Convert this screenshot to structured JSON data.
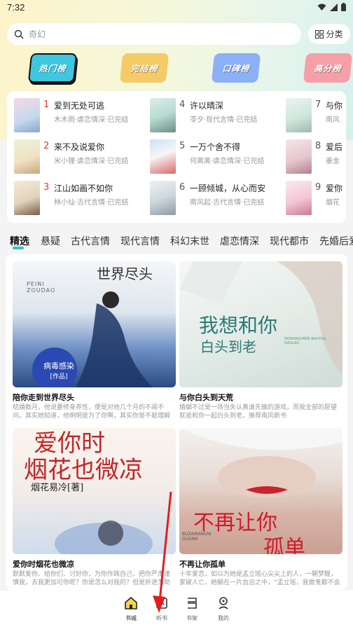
{
  "status": {
    "time": "7:32"
  },
  "search": {
    "placeholder": "奇幻"
  },
  "category_button": {
    "label": "分类",
    "icon": "grid-icon"
  },
  "rank_tabs": [
    {
      "label": "热门榜",
      "color": "#3fc7df",
      "active": true
    },
    {
      "label": "完结榜",
      "color": "#f4cb66"
    },
    {
      "label": "口碑榜",
      "color": "#8cb0f5"
    },
    {
      "label": "高分榜",
      "color": "#f5a0a8"
    }
  ],
  "rankings": [
    {
      "num": "1",
      "title": "爱到无处可逃",
      "meta": "木木雨·虐恋情深·已完结"
    },
    {
      "num": "2",
      "title": "来不及说爱你",
      "meta": "米小狸·虐恋情深·已完结"
    },
    {
      "num": "3",
      "title": "江山如画不如你",
      "meta": "林小仙·古代言情·已完结"
    },
    {
      "num": "4",
      "title": "许以晴深",
      "meta": "苓夕·现代言情·已完结"
    },
    {
      "num": "5",
      "title": "一万个舍不得",
      "meta": "何离离·虐恋情深·已完结"
    },
    {
      "num": "6",
      "title": "一顾倾城，从心而安",
      "meta": "南风起·古代言情·已完结"
    },
    {
      "num": "7",
      "title": "与你",
      "meta": "南风"
    },
    {
      "num": "8",
      "title": "爱后",
      "meta": "墨金"
    },
    {
      "num": "9",
      "title": "爱你",
      "meta": "烟花"
    }
  ],
  "rank_colors": {
    "top3": "#e53935",
    "rest": "#555555"
  },
  "genre_tabs": [
    "精选",
    "悬疑",
    "古代言情",
    "现代言情",
    "科幻末世",
    "虐恋情深",
    "现代都市",
    "先婚后爱"
  ],
  "books": [
    {
      "title": "陪你走到世界尽头",
      "desc": "结婚数月，他说要修身养性，便是对他几个月的不闻不问。其实她知道，他明明是为了你啊，其实你是不能理解我的意思吗？可...",
      "cover_text": "世界尽头",
      "cover_sub": "PEINI ZOUDAO",
      "cover_badge": "病毒感染",
      "cover_badge2": "[作品]"
    },
    {
      "title": "与你白头到天荒",
      "desc": "婚姻不过是一场当失认真谁先输的游戏，而我全部的愿望就是和你一起白头到老。推荐南风新书",
      "cover_text": "我想和你",
      "cover_text2": "白头到老",
      "cover_sub": "WOXIANGHENI BAOTOU DAOLAO"
    },
    {
      "title": "爱你时烟花也微凉",
      "desc": "默默爱你、给你们、讨好你，为你作践自己，把你严肃谨慎我，去我更加可你呢？你是怎么对我的？但是折进为助不发的烦恼？...",
      "cover_text": "爱你时",
      "cover_text2": "烟花也微凉",
      "cover_author": "烟花易冷[著]"
    },
    {
      "title": "不再让你孤单",
      "desc": "十年爱恋，如以为她是孟立瑶心尖尖上的人，一朝梦醒，家破人亡，她躺在一片血泊之中，“孟立瑶，我做鬼都不会放过你...",
      "cover_text": "不再让你",
      "cover_text2": "孤单",
      "cover_sub": "BUZAIRANGNI GUDAN"
    }
  ],
  "nav": [
    {
      "label": "书城",
      "icon": "home-icon",
      "active": true
    },
    {
      "label": "听书",
      "icon": "headphone-icon"
    },
    {
      "label": "书架",
      "icon": "bookshelf-icon"
    },
    {
      "label": "我的",
      "icon": "profile-icon"
    }
  ]
}
